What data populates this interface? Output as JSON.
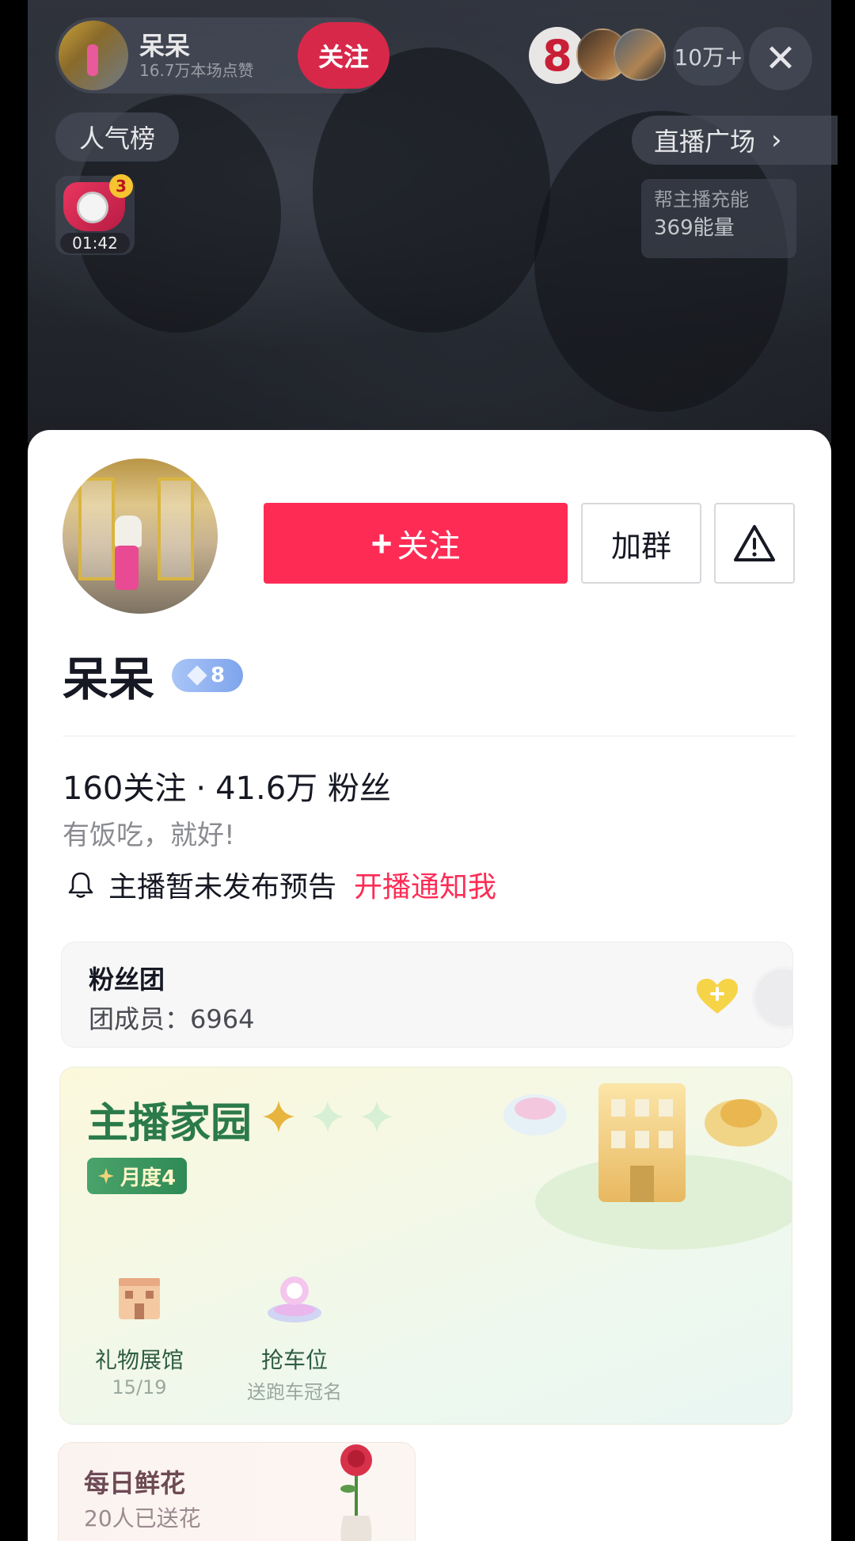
{
  "stream": {
    "host_name": "呆呆",
    "host_likes": "16.7万本场点赞",
    "follow_label": "关注",
    "rank_number": "8",
    "viewer_count": "10万+",
    "close_glyph": "✕",
    "popular_label": "人气榜",
    "gift_badge": "3",
    "gift_timer": "01:42",
    "square_label": "直播广场",
    "square_chevron": "›",
    "energy_label": "帮主播充能",
    "energy_value": "369能量"
  },
  "profile": {
    "follow_button": "关注",
    "follow_plus": "+",
    "group_button": "加群",
    "report_icon": "warning-triangle-icon",
    "name": "呆呆",
    "level": "8",
    "following_count": "160",
    "following_label": "关注",
    "separator": "·",
    "fans_count": "41.6万",
    "fans_label": "粉丝",
    "bio": "有饭吃，就好!",
    "notify_text": "主播暂未发布预告",
    "notify_link": "开播通知我"
  },
  "fan_club": {
    "title": "粉丝团",
    "members": "团成员：6964"
  },
  "home": {
    "title": "主播家园",
    "badge": "月度4",
    "stars_lit": 1,
    "stars_total": 3,
    "items": [
      {
        "label": "礼物展馆",
        "sub": "15/19"
      },
      {
        "label": "抢车位",
        "sub": "送跑车冠名"
      }
    ]
  },
  "flower": {
    "title": "每日鲜花",
    "sub": "20人已送花"
  },
  "colors": {
    "accent": "#fe2c55",
    "home_green": "#2b7a4a",
    "level_blue": "#7ea4ec"
  }
}
